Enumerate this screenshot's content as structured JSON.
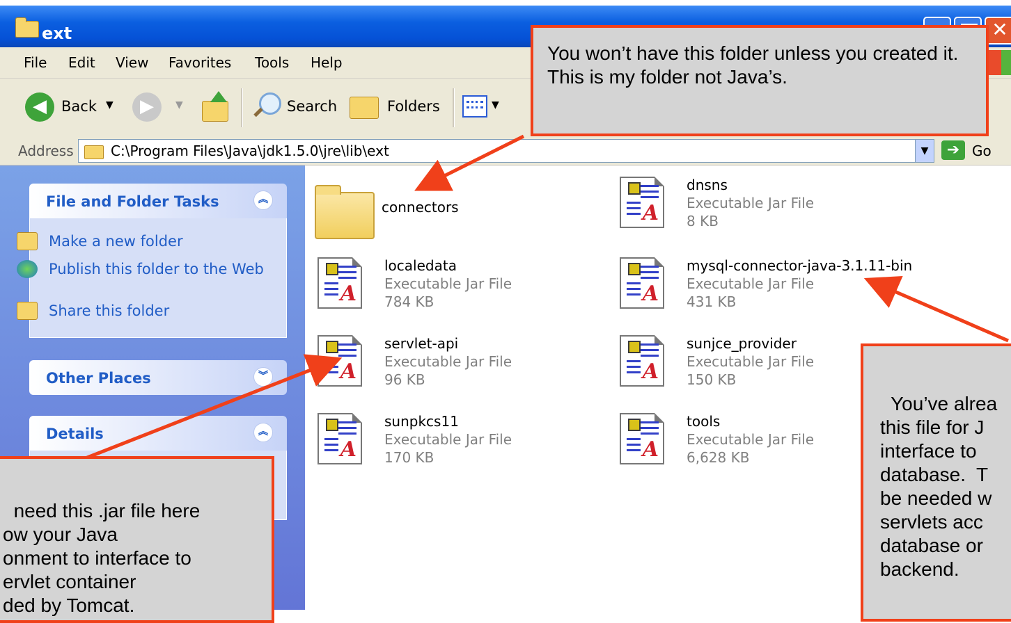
{
  "window": {
    "title": "ext"
  },
  "menu": [
    "File",
    "Edit",
    "View",
    "Favorites",
    "Tools",
    "Help"
  ],
  "toolbar": {
    "back": "Back",
    "search": "Search",
    "folders": "Folders"
  },
  "address": {
    "label": "Address",
    "path": "C:\\Program Files\\Java\\jdk1.5.0\\jre\\lib\\ext",
    "go": "Go"
  },
  "left_pane": {
    "tasks_title": "File and Folder Tasks",
    "tasks": [
      "Make a new folder",
      "Publish this folder to the Web",
      "Share this folder"
    ],
    "other_places_title": "Other Places",
    "details_title": "Details"
  },
  "files": [
    {
      "name": "connectors",
      "type": "",
      "size": ""
    },
    {
      "name": "dnsns",
      "type": "Executable Jar File",
      "size": "8 KB"
    },
    {
      "name": "localedata",
      "type": "Executable Jar File",
      "size": "784 KB"
    },
    {
      "name": "mysql-connector-java-3.1.11-bin",
      "type": "Executable Jar File",
      "size": "431 KB"
    },
    {
      "name": "servlet-api",
      "type": "Executable Jar File",
      "size": "96 KB"
    },
    {
      "name": "sunjce_provider",
      "type": "Executable Jar File",
      "size": "150 KB"
    },
    {
      "name": "sunpkcs11",
      "type": "Executable Jar File",
      "size": "170 KB"
    },
    {
      "name": "tools",
      "type": "Executable Jar File",
      "size": "6,628 KB"
    }
  ],
  "callouts": {
    "top": "You won’t have this folder unless you created it.  This is my folder not Java’s.",
    "left": "need this .jar file here\now your Java\nonment to interface to\nervlet container\nded by Tomcat.",
    "right": "You’ve alrea\nthis file for J\ninterface to \ndatabase.  T\nbe needed w\nservlets acc\ndatabase or\nbackend."
  },
  "colors": {
    "title_bar": "#0551d6",
    "task_link": "#215dc6",
    "callout_border": "#f0401a",
    "callout_bg": "#d4d4d4"
  }
}
